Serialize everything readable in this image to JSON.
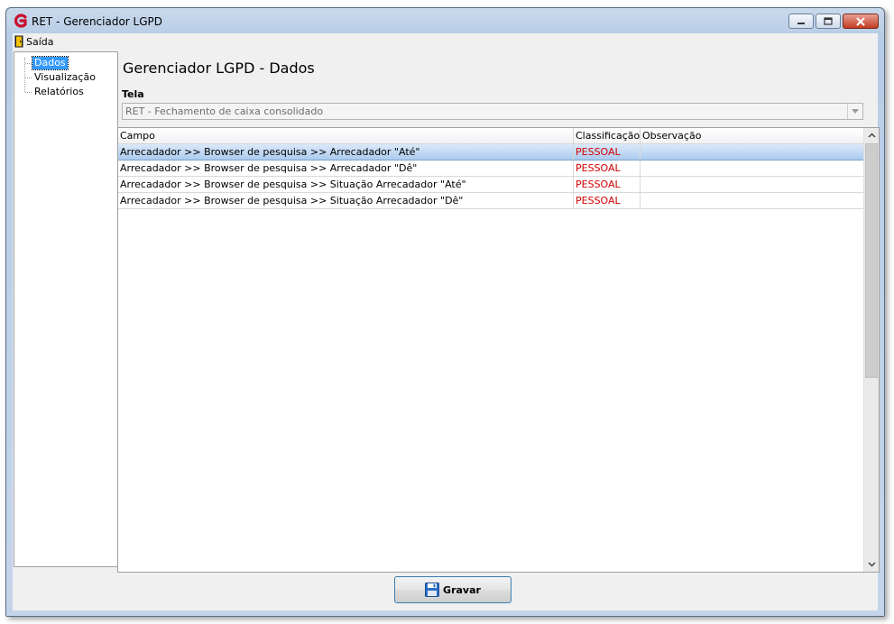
{
  "window": {
    "title": "RET - Gerenciador LGPD"
  },
  "menu": {
    "exit_label": "Saída"
  },
  "tree": {
    "items": [
      {
        "label": "Dados",
        "selected": true
      },
      {
        "label": "Visualização",
        "selected": false
      },
      {
        "label": "Relatórios",
        "selected": false
      }
    ]
  },
  "main": {
    "title": "Gerenciador LGPD - Dados",
    "tela_label": "Tela",
    "tela_value": "RET - Fechamento de caixa consolidado"
  },
  "grid": {
    "columns": [
      "Campo",
      "Classificação",
      "Observação"
    ],
    "rows": [
      {
        "campo": "Arrecadador >> Browser de pesquisa >> Arrecadador \"Até\"",
        "classificacao": "PESSOAL",
        "observacao": "",
        "selected": true
      },
      {
        "campo": "Arrecadador >> Browser de pesquisa >> Arrecadador \"Dê\"",
        "classificacao": "PESSOAL",
        "observacao": "",
        "selected": false
      },
      {
        "campo": "Arrecadador >> Browser de pesquisa >> Situação Arrecadador \"Até\"",
        "classificacao": "PESSOAL",
        "observacao": "",
        "selected": false
      },
      {
        "campo": "Arrecadador >> Browser de pesquisa >> Situação Arrecadador \"Dê\"",
        "classificacao": "PESSOAL",
        "observacao": "",
        "selected": false
      }
    ]
  },
  "footer": {
    "save_label": "Gravar"
  },
  "colors": {
    "classification_text": "#d40000",
    "selection": "#3399ff",
    "row_selection": "#b7d3f2"
  }
}
